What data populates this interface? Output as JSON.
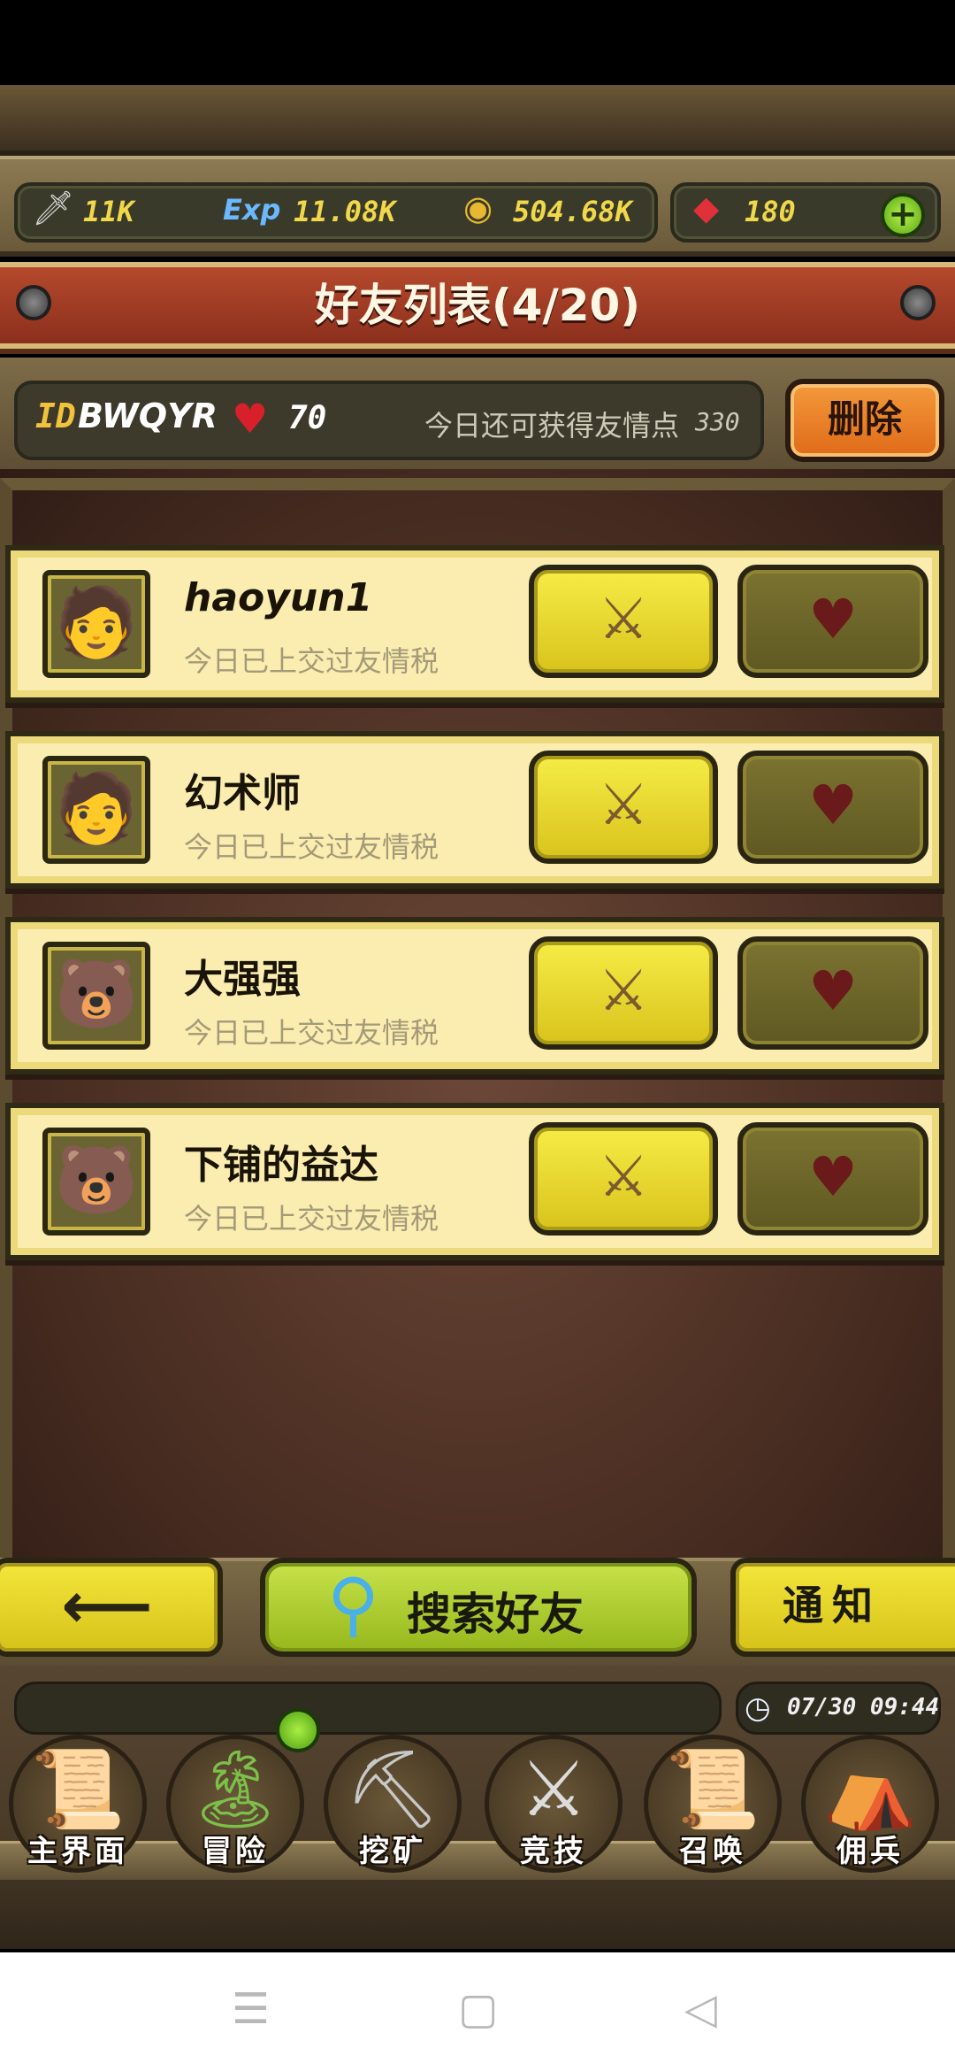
{
  "resources": {
    "attack": "11K",
    "exp_label": "Exp",
    "exp": "11.08K",
    "gold": "504.68K",
    "gems": "180"
  },
  "title": "好友列表(4/20)",
  "user": {
    "id_prefix": "ID",
    "id": "BWQYR",
    "hearts": "70",
    "daily_label": "今日还可获得友情点",
    "daily_value": "330",
    "delete_label": "删除"
  },
  "friends": [
    {
      "name": "haoyun1",
      "status": "今日已上交过友情税",
      "avatar_icon": "warrior-avatar-icon"
    },
    {
      "name": "幻术师",
      "status": "今日已上交过友情税",
      "avatar_icon": "warrior-avatar-icon"
    },
    {
      "name": "大强强",
      "status": "今日已上交过友情税",
      "avatar_icon": "bear-avatar-icon"
    },
    {
      "name": "下铺的益达",
      "status": "今日已上交过友情税",
      "avatar_icon": "bear-avatar-icon"
    }
  ],
  "buttons": {
    "back_arrow": "⟵",
    "search_friend": "搜索好友",
    "notify": "通知"
  },
  "clock": "07/30 09:44",
  "nav": [
    {
      "label": "主界面",
      "icon": "scroll-map-icon"
    },
    {
      "label": "冒险",
      "icon": "island-icon"
    },
    {
      "label": "挖矿",
      "icon": "pickaxe-icon"
    },
    {
      "label": "竞技",
      "icon": "crossed-swords-icon"
    },
    {
      "label": "召唤",
      "icon": "summon-scroll-icon"
    },
    {
      "label": "佣兵",
      "icon": "tent-icon"
    }
  ],
  "colors": {
    "title_banner": "#a83c24",
    "row_background": "#fbedb0",
    "fight_button": "#f0e23a",
    "heart_button": "#6e6628",
    "delete_button": "#ec7e28",
    "search_button": "#b4d232"
  }
}
